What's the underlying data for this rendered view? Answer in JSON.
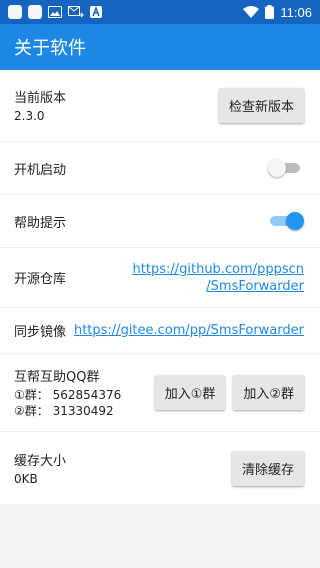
{
  "status_bar": {
    "time": "11:06",
    "icons": [
      "app-icon",
      "app-icon",
      "image-icon",
      "email-icon",
      "text-icon",
      "wifi-icon",
      "battery-icon"
    ]
  },
  "app_bar": {
    "title": "关于软件"
  },
  "rows": {
    "version": {
      "label": "当前版本",
      "value": "2.3.0",
      "button": "检查新版本"
    },
    "autostart": {
      "label": "开机启动",
      "switch_on": false
    },
    "help_tips": {
      "label": "帮助提示",
      "switch_on": true
    },
    "repo": {
      "label": "开源仓库",
      "link_line1": "https://github.com/pppscn",
      "link_line2": "/SmsForwarder"
    },
    "mirror": {
      "label": "同步镜像",
      "link": "https://gitee.com/pp/SmsForwarder"
    },
    "qq": {
      "label": "互帮互助QQ群",
      "group1": "①群：  562854376",
      "group2": "②群：  31330492",
      "button1": "加入①群",
      "button2": "加入②群"
    },
    "cache": {
      "label": "缓存大小",
      "value": "0KB",
      "button": "清除缓存"
    }
  },
  "colors": {
    "status_bar": "#1565c0",
    "app_bar": "#1e88e5",
    "accent": "#2196f3",
    "link": "#1e88e5"
  }
}
